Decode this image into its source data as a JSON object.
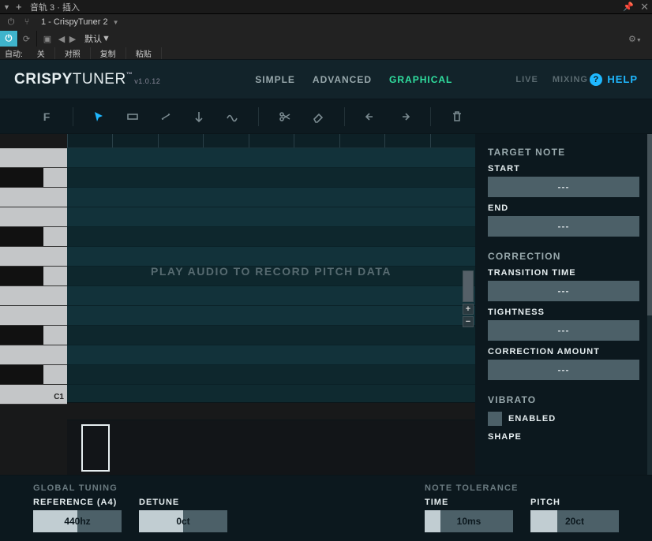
{
  "host": {
    "title": "音轨 3 · 插入",
    "preset_slot": "1 - CrispyTuner 2",
    "row3": {
      "preset": "默认"
    },
    "row4": {
      "auto": "自动:",
      "off": "关",
      "compare": "对照",
      "copy": "复制",
      "paste": "粘贴"
    }
  },
  "header": {
    "logo_bold": "CRISPY",
    "logo_reg": "TUNER",
    "tm": "™",
    "version": "v1.0.12",
    "nav": {
      "simple": "SIMPLE",
      "advanced": "ADVANCED",
      "graphical": "GRAPHICAL"
    },
    "nav2": {
      "live": "LIVE",
      "mixing": "MIXING"
    },
    "help": "HELP"
  },
  "toolbar": {
    "note_filter": "F"
  },
  "grid": {
    "placeholder": "PLAY AUDIO TO RECORD PITCH DATA",
    "c1": "C1"
  },
  "side": {
    "target_note": "TARGET NOTE",
    "start": "START",
    "end": "END",
    "correction": "CORRECTION",
    "transition": "TRANSITION TIME",
    "tightness": "TIGHTNESS",
    "amount": "CORRECTION AMOUNT",
    "vibrato": "VIBRATO",
    "enabled": "ENABLED",
    "shape": "SHAPE",
    "val_start": "---",
    "val_end": "---",
    "val_transition": "---",
    "val_tightness": "---",
    "val_amount": "---"
  },
  "bottom": {
    "global": "GLOBAL TUNING",
    "reference": "REFERENCE (A4)",
    "detune": "DETUNE",
    "ref_val": "440hz",
    "detune_val": "0ct",
    "tolerance": "NOTE TOLERANCE",
    "time": "TIME",
    "pitch": "PITCH",
    "time_val": "10ms",
    "pitch_val": "20ct"
  }
}
